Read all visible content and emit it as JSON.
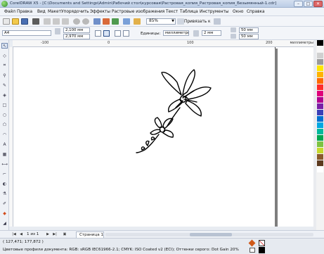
{
  "window": {
    "title": "CorelDRAW X5 - [C:\\Documents and Settings\\Admin\\Рабочий стол\\курсовая\\Растровая_копия_Растровая_копия_Безымянный-1.cdr]",
    "minimize": "–",
    "maximize": "□",
    "close": "✕"
  },
  "menu": {
    "items": [
      "Файл",
      "Правка",
      "Вид",
      "Макет",
      "Упорядочить",
      "Эффекты",
      "Растровые изображения",
      "Текст",
      "Таблица",
      "Инструменты",
      "Окно",
      "Справка"
    ]
  },
  "toolbar": {
    "zoom_value": "85%",
    "snap_label": "Привязать к"
  },
  "properties": {
    "page_preset": "А4",
    "page_width": "2,100 мм",
    "page_height": "2,970 мм",
    "units_label": "Единицы:",
    "units_value": "миллиметры",
    "nudge_value": "2 мм",
    "dup_x": "50 мм",
    "dup_y": "50 мм"
  },
  "ruler": {
    "ticks": [
      "-100",
      "0",
      "100",
      "200"
    ],
    "unit": "миллиметры"
  },
  "pagebar": {
    "page_counter": "1 из 1",
    "page_tab": "Страница 1"
  },
  "status": {
    "coordinates": "( 127,471; 177,872 )",
    "color_profile": "Цветовые профили документа: RGB: sRGB IEC61966-2.1; CMYK: ISO Coated v2 (ECI); Оттенки серого: Dot Gain 20%"
  },
  "palette_colors": [
    "#000000",
    "#f7f7f7",
    "#d0d0d0",
    "#9a9a9a",
    "#ffe600",
    "#ffb300",
    "#ff6a00",
    "#ff2b2b",
    "#e0007a",
    "#b1008f",
    "#7a1fa6",
    "#3b3fb7",
    "#0070d0",
    "#00a7e1",
    "#00b89c",
    "#00a650",
    "#7dc242",
    "#c6d82d",
    "#8a5a2b",
    "#5c3a1e",
    "#ffffff"
  ]
}
